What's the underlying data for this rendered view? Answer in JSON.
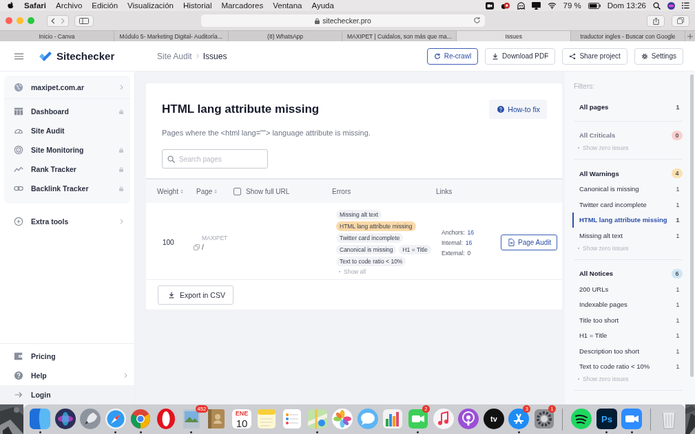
{
  "menubar": {
    "app": "Safari",
    "menus": [
      "Archivo",
      "Edición",
      "Visualización",
      "Historial",
      "Marcadores",
      "Ventana",
      "Ayuda"
    ],
    "battery": "79 %",
    "clock": "Dom 13:26"
  },
  "browser": {
    "url": "sitechecker.pro",
    "tabs": [
      {
        "title": "Inicio - Canva",
        "selected": false
      },
      {
        "title": "Módulo 5- Marketing Digital- Auditoría...",
        "selected": false
      },
      {
        "title": "(8) WhatsApp",
        "selected": false
      },
      {
        "title": "MAXIPET | Cuidalos, son más que ma...",
        "selected": false
      },
      {
        "title": "Issues",
        "selected": true
      },
      {
        "title": "traductor ingles - Buscar con Google",
        "selected": false
      }
    ]
  },
  "header": {
    "brand": "Sitechecker",
    "breadcrumb": [
      "Site Audit",
      "Issues"
    ],
    "actions": [
      {
        "label": "Re-crawl",
        "primary": true
      },
      {
        "label": "Download PDF",
        "primary": false
      },
      {
        "label": "Share project",
        "primary": false
      },
      {
        "label": "Settings",
        "primary": false
      }
    ]
  },
  "sidebar": {
    "project": "maxipet.com.ar",
    "items": [
      {
        "label": "Dashboard",
        "kind": "dashboard",
        "locked": true
      },
      {
        "label": "Site Audit",
        "kind": "gauge",
        "locked": false
      },
      {
        "label": "Site Monitoring",
        "kind": "radar",
        "locked": true
      },
      {
        "label": "Rank Tracker",
        "kind": "trend",
        "locked": true
      },
      {
        "label": "Backlink Tracker",
        "kind": "link",
        "locked": true
      }
    ],
    "extra": "Extra tools",
    "footer": [
      {
        "label": "Pricing",
        "kind": "wallet",
        "chevron": false,
        "selected": false
      },
      {
        "label": "Help",
        "kind": "help",
        "chevron": true,
        "selected": false
      },
      {
        "label": "Login",
        "kind": "arrow",
        "chevron": false,
        "selected": true
      }
    ]
  },
  "issue": {
    "title": "HTML lang attribute missing",
    "description": "Pages where the <html lang=\"\"> language attribute is missing.",
    "how_to_fix": "How-to fix",
    "search_placeholder": "Search pages"
  },
  "table": {
    "columns": [
      {
        "label": "Weight",
        "sortable": true
      },
      {
        "label": "Page",
        "sortable": true
      },
      {
        "label": "Errors",
        "sortable": false
      },
      {
        "label": "Links",
        "sortable": false
      }
    ],
    "show_full_url": {
      "label": "Show full URL",
      "checked": false
    },
    "rows": [
      {
        "weight": "100",
        "page_title": "MAXIPET",
        "path": "/",
        "error_lines": [
          [
            {
              "label": "Missing alt text",
              "selected": false
            }
          ],
          [
            {
              "label": "HTML lang attribute missing",
              "selected": true
            }
          ],
          [
            {
              "label": "Twitter card incomplete",
              "selected": false
            }
          ],
          [
            {
              "label": "Canonical is missing",
              "selected": false
            },
            {
              "label": "H1 = Title",
              "selected": false
            }
          ],
          [
            {
              "label": "Text to code ratio < 10%",
              "selected": false
            }
          ]
        ],
        "show_all": "Show all",
        "links": [
          {
            "label": "Anchors:",
            "value": "16",
            "linked": true
          },
          {
            "label": "Internal:",
            "value": "16",
            "linked": true
          },
          {
            "label": "External:",
            "value": "0",
            "linked": false
          }
        ],
        "action": "Page Audit"
      }
    ]
  },
  "export": "Export in CSV",
  "filters": {
    "label": "Filters:",
    "groups": [
      {
        "title": "All pages",
        "count": "1",
        "muted": false
      },
      {
        "title": "All Criticals",
        "count": "0",
        "color": "#f9d0d0",
        "muted": true,
        "show_zero": "Show zero issues"
      },
      {
        "title": "All Warnings",
        "count": "4",
        "color": "#fbe2b2",
        "muted": false,
        "items": [
          {
            "label": "Canonical is missing",
            "count": "1",
            "selected": false
          },
          {
            "label": "Twitter card incomplete",
            "count": "1",
            "selected": false
          },
          {
            "label": "HTML lang attribute missing",
            "count": "1",
            "selected": true
          },
          {
            "label": "Missing alt text",
            "count": "1",
            "selected": false
          }
        ],
        "show_zero": "Show zero issues"
      },
      {
        "title": "All Notices",
        "count": "6",
        "color": "#cfe6f6",
        "muted": false,
        "items": [
          {
            "label": "200 URLs",
            "count": "1",
            "selected": false
          },
          {
            "label": "Indexable pages",
            "count": "1",
            "selected": false
          },
          {
            "label": "Title too short",
            "count": "1",
            "selected": false
          },
          {
            "label": "H1 = Title",
            "count": "1",
            "selected": false
          },
          {
            "label": "Description too short",
            "count": "1",
            "selected": false
          },
          {
            "label": "Text to code ratio < 10%",
            "count": "1",
            "selected": false
          }
        ],
        "show_zero": "Show zero issues"
      }
    ]
  },
  "dock": [
    {
      "kind": "finder",
      "running": true
    },
    {
      "kind": "siri",
      "running": false
    },
    {
      "kind": "launchpad",
      "running": false
    },
    {
      "kind": "safari",
      "running": true
    },
    {
      "kind": "chrome",
      "running": true
    },
    {
      "kind": "opera",
      "running": false
    },
    {
      "kind": "preview",
      "running": true,
      "badge": "452"
    },
    {
      "kind": "contacts",
      "running": false
    },
    {
      "kind": "calendar",
      "running": false,
      "month": "ENE",
      "day": "10"
    },
    {
      "kind": "notes",
      "running": false
    },
    {
      "kind": "reminders",
      "running": false
    },
    {
      "kind": "maps",
      "running": true
    },
    {
      "kind": "photos",
      "running": false
    },
    {
      "kind": "messages",
      "running": false
    },
    {
      "kind": "numbers",
      "running": false
    },
    {
      "kind": "facetime",
      "running": true,
      "badge": "2"
    },
    {
      "kind": "music",
      "running": false
    },
    {
      "kind": "podcasts",
      "running": false
    },
    {
      "kind": "tv",
      "running": false,
      "text": "tv"
    },
    {
      "kind": "appstore",
      "running": true,
      "badge": "3"
    },
    {
      "kind": "sysprefs",
      "running": false,
      "badge": "1"
    },
    {
      "kind": "divider"
    },
    {
      "kind": "spotify",
      "running": false
    },
    {
      "kind": "ps",
      "running": true,
      "text": "Ps"
    },
    {
      "kind": "zoom",
      "running": true
    },
    {
      "kind": "divider"
    },
    {
      "kind": "trash",
      "running": false
    }
  ]
}
